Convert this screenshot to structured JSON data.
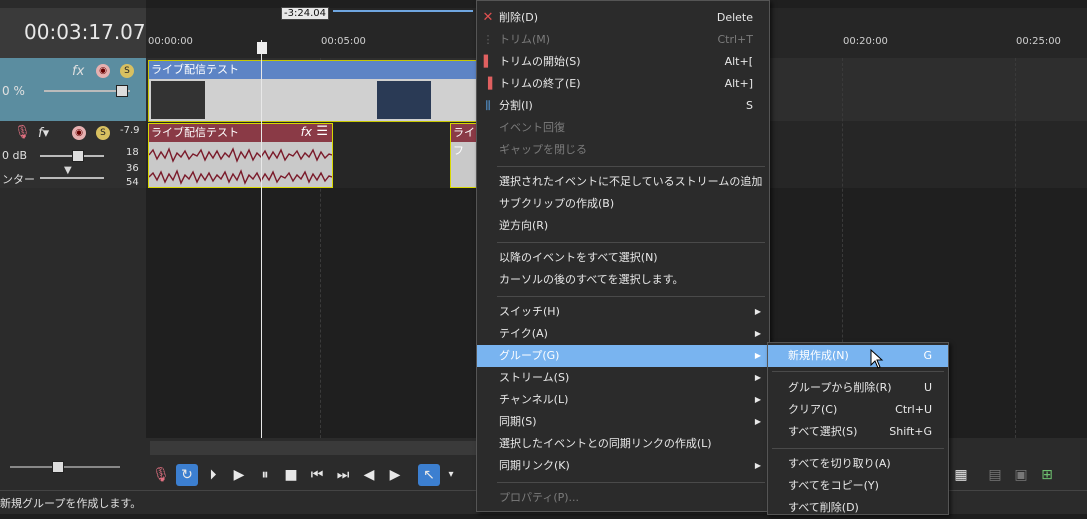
{
  "transport": {
    "time": "00:03:17.07",
    "duration_label": "-3:24.04"
  },
  "ruler": {
    "ticks": [
      "00:00:00",
      "00:05:00",
      "00:20:00",
      "00:25:00"
    ]
  },
  "video_track": {
    "level": "0 %",
    "clip_title": "ライブ配信テスト"
  },
  "audio_track": {
    "level": "0 dB",
    "pan": "ンター",
    "meter_top": "-7.9",
    "meter_marks": [
      "18",
      "36",
      "54"
    ],
    "clip_title": "ライブ配信テスト",
    "clip2_title": "ライフ"
  },
  "context_menu": {
    "items": [
      {
        "label": "削除(D)",
        "shortcut": "Delete",
        "icon": "delete-x-icon"
      },
      {
        "label": "トリム(M)",
        "shortcut": "Ctrl+T",
        "disabled": true
      },
      {
        "label": "トリムの開始(S)",
        "shortcut": "Alt+["
      },
      {
        "label": "トリムの終了(E)",
        "shortcut": "Alt+]"
      },
      {
        "label": "分割(I)",
        "shortcut": "S"
      },
      {
        "label": "イベント回復",
        "disabled": true
      },
      {
        "label": "ギャップを閉じる",
        "disabled": true
      },
      {
        "label": "選択されたイベントに不足しているストリームの追加"
      },
      {
        "label": "サブクリップの作成(B)"
      },
      {
        "label": "逆方向(R)"
      },
      {
        "label": "以降のイベントをすべて選択(N)"
      },
      {
        "label": "カーソルの後のすべてを選択します。"
      },
      {
        "label": "スイッチ(H)"
      },
      {
        "label": "テイク(A)"
      },
      {
        "label": "グループ(G)"
      },
      {
        "label": "ストリーム(S)"
      },
      {
        "label": "チャンネル(L)"
      },
      {
        "label": "同期(S)"
      },
      {
        "label": "選択したイベントとの同期リンクの作成(L)"
      },
      {
        "label": "同期リンク(K)"
      },
      {
        "label": "プロパティ(P)...",
        "disabled": true
      }
    ]
  },
  "submenu": {
    "items": [
      {
        "label": "新規作成(N)",
        "shortcut": "G"
      },
      {
        "label": "グループから削除(R)",
        "shortcut": "U"
      },
      {
        "label": "クリア(C)",
        "shortcut": "Ctrl+U"
      },
      {
        "label": "すべて選択(S)",
        "shortcut": "Shift+G"
      },
      {
        "label": "すべてを切り取り(A)"
      },
      {
        "label": "すべてをコピー(Y)"
      },
      {
        "label": "すべて削除(D)"
      }
    ]
  },
  "status": {
    "text": "新規グループを作成します。"
  },
  "colors": {
    "highlight": "#79b4f0",
    "video_clip_header": "#5d84c5",
    "audio_clip_header": "#8a3a46",
    "clip_border": "#d8d800"
  }
}
